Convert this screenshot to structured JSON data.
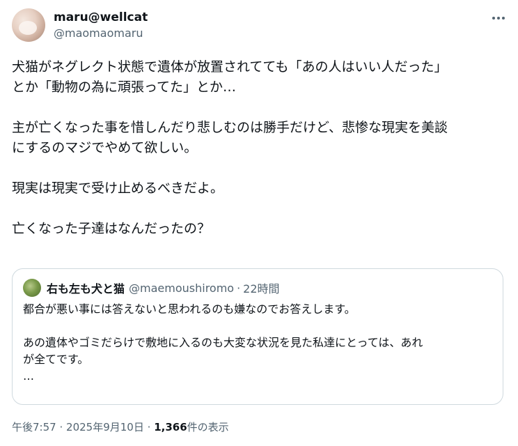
{
  "author": {
    "display_name": "maru@wellcat",
    "handle": "@maomaomaru"
  },
  "tweet": {
    "lines": [
      "犬猫がネグレクト状態で遺体が放置されてても「あの人はいい人だった」",
      "とか「動物の為に頑張ってた」とか…",
      "",
      "主が亡くなった事を惜しんだり悲しむのは勝手だけど、悲惨な現実を美談",
      "にするのマジでやめて欲しい。",
      "",
      "現実は現実で受け止めるべきだよ。",
      "",
      "亡くなった子達はなんだったの？"
    ]
  },
  "quote": {
    "display_name": "右も左も犬と猫",
    "handle": "@maemoushiromo",
    "separator": "·",
    "time": "22時間",
    "lines": [
      "都合が悪い事には答えないと思われるのも嫌なのでお答えします。",
      "",
      "あの遺体やゴミだらけで敷地に入るのも大変な状況を見た私達にとっては、あれ",
      "が全てです。",
      "…"
    ]
  },
  "footer": {
    "time": "午後7:57",
    "date": "2025年9月10日",
    "separator": "·",
    "views_count": "1,366",
    "views_label": "件の表示"
  },
  "icons": {
    "more": "more-horizontal-icon"
  },
  "colors": {
    "text": "#0f1419",
    "secondary": "#536471",
    "border": "#cfd9de"
  }
}
